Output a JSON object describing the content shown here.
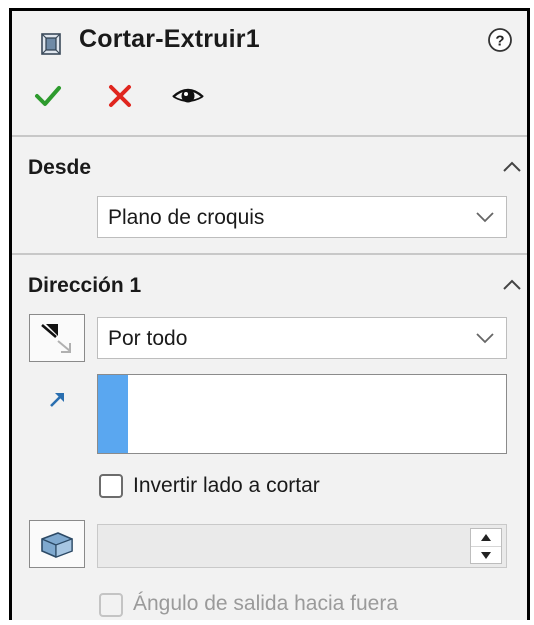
{
  "header": {
    "title": "Cortar-Extruir1",
    "feature_icon": "cut-extrude-feature-icon",
    "help_icon": "help-icon"
  },
  "actions": {
    "ok_icon": "green-checkmark-icon",
    "cancel_icon": "red-x-icon",
    "preview_icon": "eye-icon"
  },
  "desde": {
    "title": "Desde",
    "select_value": "Plano de croquis"
  },
  "direccion1": {
    "title": "Dirección 1",
    "end_condition": "Por todo",
    "selection_value": "",
    "invert_label": "Invertir lado a cortar",
    "invert_checked": false,
    "depth_value": "",
    "draft_label": "Ángulo de salida hacia fuera",
    "draft_enabled": false
  },
  "colors": {
    "selection_accent": "#5aa7f0",
    "ok": "#2e9b2e",
    "cancel": "#e0261f",
    "arrow": "#2a6fb0"
  }
}
